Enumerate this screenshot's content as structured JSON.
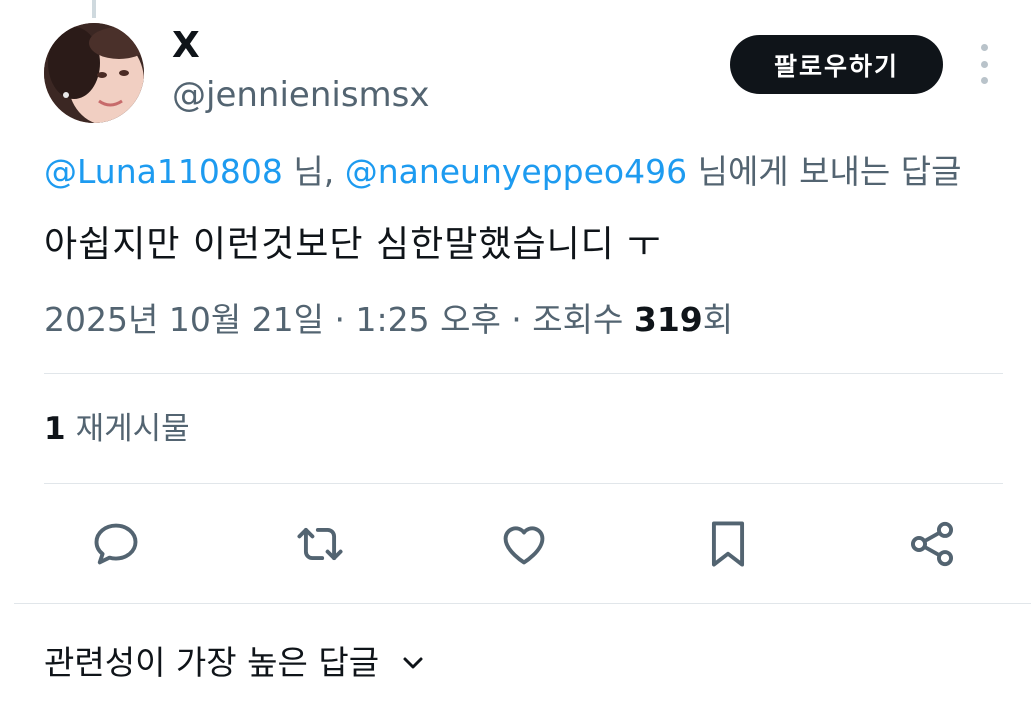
{
  "author": {
    "display_name": "X",
    "handle": "@jennienismsx"
  },
  "follow_button_label": "팔로우하기",
  "reply_context": {
    "mention_1": "@Luna110808",
    "suffix_1": " 님, ",
    "mention_2": "@naneunyeppeo496",
    "suffix_2": " 님에게 보내는 답글"
  },
  "tweet": {
    "text": "아쉽지만 이런것보단 심한말했습니디 ㅜ",
    "timestamp": "2025년 10월 21일 · 1:25 오후 · 조회수 ",
    "views": "319",
    "views_suffix": "회"
  },
  "stats": {
    "repost_count": "1",
    "repost_label": "재게시물"
  },
  "actions": [
    "reply-icon",
    "retweet-icon",
    "like-icon",
    "bookmark-icon",
    "share-icon"
  ],
  "replies_sort": {
    "label": "관련성이 가장 높은 답글"
  },
  "colors": {
    "accent": "#1d9bf0",
    "text_primary": "#0f1419",
    "text_secondary": "#536471",
    "icon": "#536471",
    "divider": "#e1e6ea"
  }
}
